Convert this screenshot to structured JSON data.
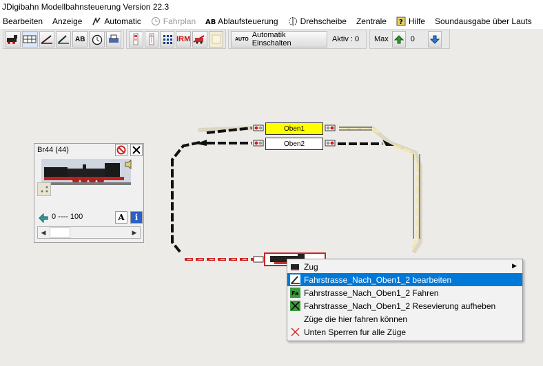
{
  "window": {
    "title": "JDigibahn Modellbahnsteuerung Version 22.3"
  },
  "menu": {
    "bearbeiten": "Bearbeiten",
    "anzeige": "Anzeige",
    "automatic": "Automatic",
    "fahrplan": "Fahrplan",
    "ablaufsteuerung": "Ablaufsteuerung",
    "drehscheibe": "Drehscheibe",
    "zentrale": "Zentrale",
    "hilfe": "Hilfe",
    "soundausgabe": "Soundausgabe über Lauts"
  },
  "toolbar": {
    "ab_label": "AB",
    "irm_label": "IRM",
    "auto_badge": "AUTO",
    "automatik_label": "Automatik Einschalten",
    "aktiv_label": "Aktiv : 0",
    "max_label": "Max",
    "max_value": "0"
  },
  "loco_panel": {
    "title": "Br44 (44)",
    "speed_range": "0 ---- 100",
    "a_label": "A",
    "info_label": "i"
  },
  "blocks": {
    "oben1": "Oben1",
    "oben2": "Oben2"
  },
  "context_menu": {
    "zug": "Zug",
    "bearbeiten": "Fahrstrasse_Nach_Oben1_2 bearbeiten",
    "fahren": "Fahrstrasse_Nach_Oben1_2 Fahren",
    "reservierung": "Fahrstrasse_Nach_Oben1_2 Resevierung aufheben",
    "zuege": "Züge die hier fahren können",
    "sperren": "Unten Sperren fur alle Züge"
  },
  "colors": {
    "selected": "#0078d7",
    "block_active": "#ffff00",
    "track_dark": "#111111",
    "track_yellow": "#f5eec0",
    "track_red": "#d02020"
  }
}
